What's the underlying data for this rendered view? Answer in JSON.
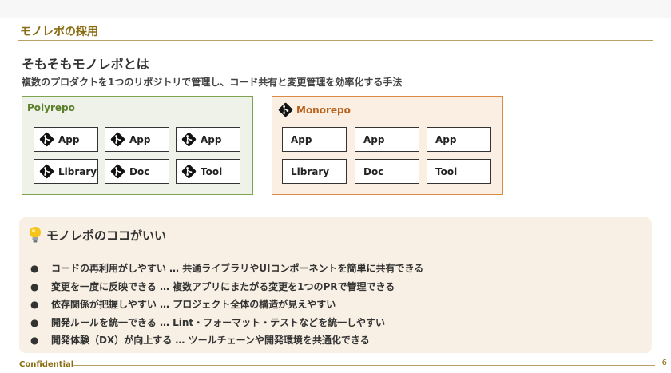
{
  "slide": {
    "section_title": "モノレポの採用",
    "heading": "そもそもモノレポとは",
    "subheading": "複数のプロダクトを1つのリポジトリで管理し、コード共有と変更管理を効率化する手法"
  },
  "polyrepo": {
    "title": "Polyrepo",
    "boxes": [
      {
        "label": "App",
        "icon": "git-icon"
      },
      {
        "label": "App",
        "icon": "git-icon"
      },
      {
        "label": "App",
        "icon": "git-icon"
      },
      {
        "label": "Library",
        "icon": "git-icon"
      },
      {
        "label": "Doc",
        "icon": "git-icon"
      },
      {
        "label": "Tool",
        "icon": "git-icon"
      }
    ]
  },
  "monorepo": {
    "title": "Monorepo",
    "icon": "git-icon",
    "boxes": [
      {
        "label": "App"
      },
      {
        "label": "App"
      },
      {
        "label": "App"
      },
      {
        "label": "Library"
      },
      {
        "label": "Doc"
      },
      {
        "label": "Tool"
      }
    ]
  },
  "benefits": {
    "title": "モノレポのココがいい",
    "icon": "lightbulb-icon",
    "bullet_symbol": "●",
    "items": [
      "コードの再利用がしやすい … 共通ライブラリやUIコンポーネントを簡単に共有できる",
      "変更を一度に反映できる … 複数アプリにまたがる変更を1つのPRで管理できる",
      "依存関係が把握しやすい … プロジェクト全体の構造が見えやすい",
      "開発ルールを統一できる … Lint・フォーマット・テストなどを統一しやすい",
      "開発体験（DX）が向上する … ツールチェーンや開発環境を共通化できる"
    ]
  },
  "footer": {
    "label": "Confidential",
    "page_number": "6"
  },
  "colors": {
    "accent": "#8a6d12",
    "poly_border": "#7fa24f",
    "poly_bg": "#eef2e9",
    "mono_border": "#dd8c48",
    "mono_bg": "#fbefe4",
    "callout_bg": "#f8f0e4"
  }
}
